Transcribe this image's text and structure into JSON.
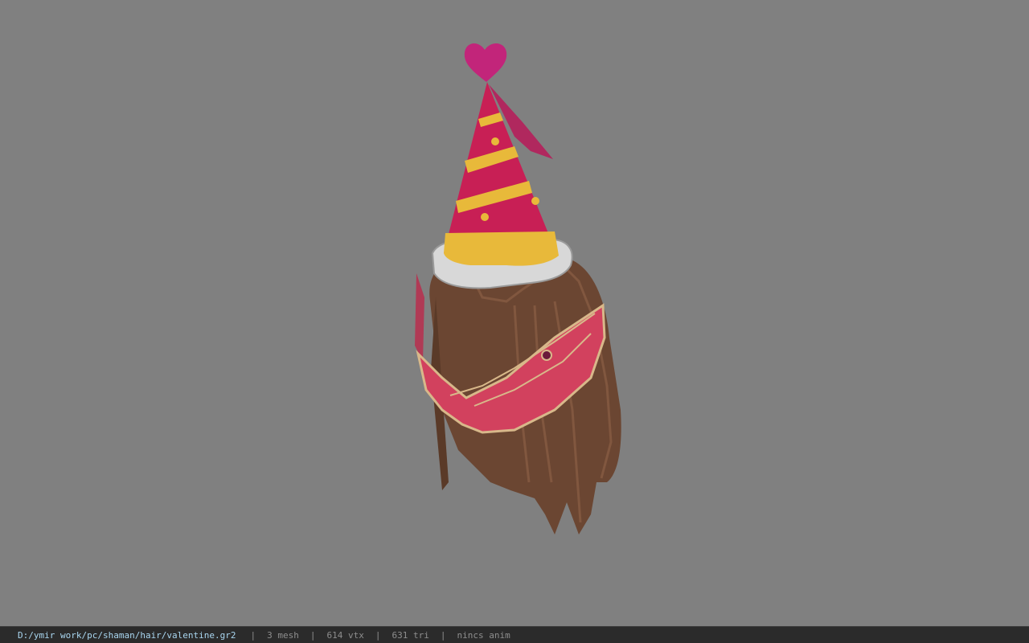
{
  "viewer": {
    "background_color": "#808080"
  },
  "model": {
    "icon": "party-hat-hair-model",
    "colors": {
      "hat_pink": "#c81f55",
      "hat_stripe": "#e8b93a",
      "fur": "#d8d8d8",
      "hair": "#6b4632",
      "mask": "#d2415e",
      "mask_trim": "#d8b88a",
      "heart": "#c2257a"
    }
  },
  "statusbar": {
    "file_path": "D:/ymir work/pc/shaman/hair/valentine.gr2",
    "separator": "|",
    "mesh_count": "3 mesh",
    "vertex_count": "614 vtx",
    "triangle_count": "631 tri",
    "anim_status": "nincs anim"
  }
}
